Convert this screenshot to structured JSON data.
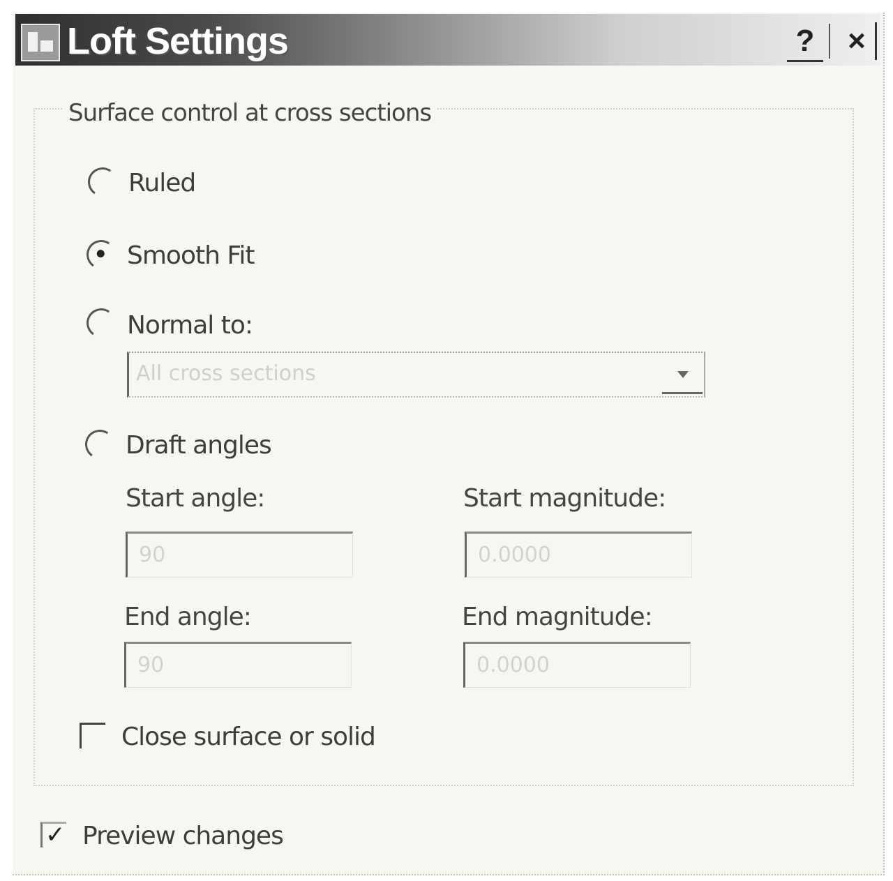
{
  "window": {
    "title": "Loft Settings",
    "help_label": "?",
    "close_label": "×"
  },
  "surface_control": {
    "group_label": "Surface control at cross sections",
    "options": [
      {
        "label": "Ruled",
        "checked": false
      },
      {
        "label": "Smooth Fit",
        "checked": true
      },
      {
        "label": "Normal to:",
        "checked": false
      },
      {
        "label": "Draft angles",
        "checked": false
      }
    ],
    "normal_to_dropdown": {
      "value": "All cross sections",
      "enabled": false
    },
    "start_angle": {
      "label": "Start angle:",
      "value": "90",
      "enabled": false
    },
    "start_magnitude": {
      "label": "Start magnitude:",
      "value": "0.0000",
      "enabled": false
    },
    "end_angle": {
      "label": "End angle:",
      "value": "90",
      "enabled": false
    },
    "end_magnitude": {
      "label": "End magnitude:",
      "value": "0.0000",
      "enabled": false
    },
    "close_surface": {
      "label": "Close surface or solid",
      "checked": false
    }
  },
  "preview_changes": {
    "label": "Preview changes",
    "checked": true
  }
}
